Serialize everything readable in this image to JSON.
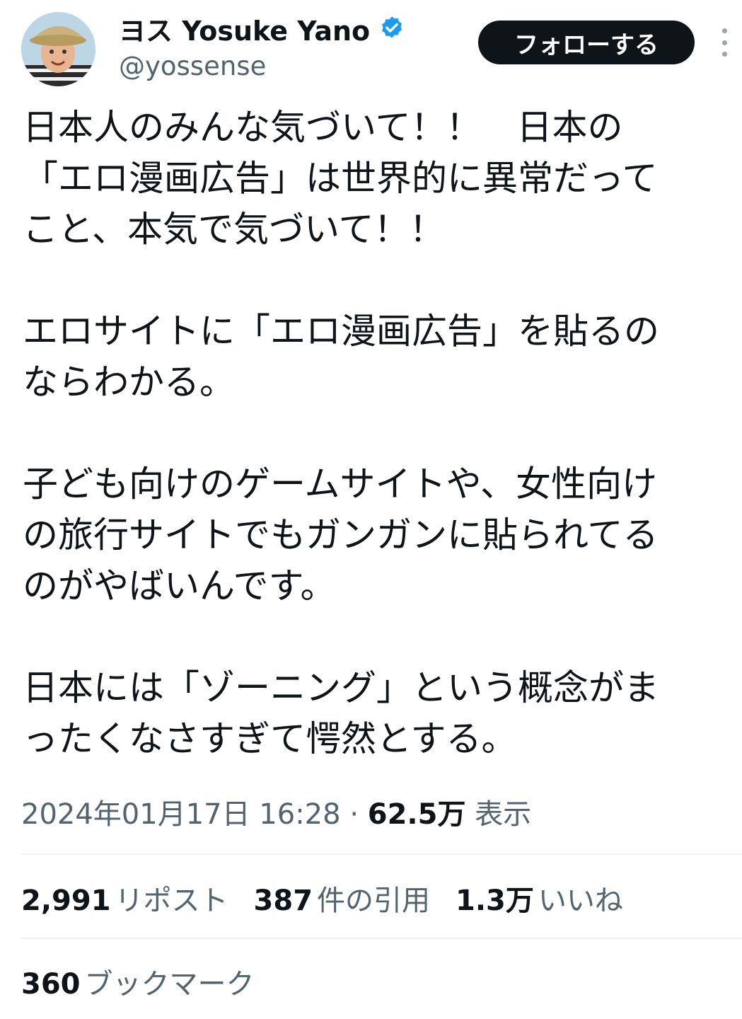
{
  "author": {
    "display_name": "ヨス Yosuke Yano",
    "handle": "@yossense",
    "verified_icon": "verified-badge-icon",
    "verified_color": "#1d9bf0"
  },
  "actions": {
    "follow_label": "フォローする",
    "more_icon": "more-vertical-icon"
  },
  "tweet": {
    "lines": [
      "日本人のみんな気づいて！！　日本の",
      "「エロ漫画広告」は世界的に異常だって",
      "こと、本気で気づいて！！",
      "",
      "エロサイトに「エロ漫画広告」を貼るの",
      "ならわかる。",
      "",
      "子ども向けのゲームサイトや、女性向け",
      "の旅行サイトでもガンガンに貼られてる",
      "のがやばいんです。",
      "",
      "日本には「ゾーニング」という概念がま",
      "ったくなさすぎて愕然とする。"
    ]
  },
  "meta": {
    "timestamp": "2024年01月17日 16:28",
    "separator": "·",
    "views_count": "62.5万",
    "views_label": "表示"
  },
  "stats": {
    "reposts_count": "2,991",
    "reposts_label": "リポスト",
    "quotes_count": "387",
    "quotes_label": "件の引用",
    "likes_count": "1.3万",
    "likes_label": "いいね",
    "bookmarks_count": "360",
    "bookmarks_label": "ブックマーク"
  },
  "colors": {
    "text": "#0f1419",
    "secondary": "#536471",
    "divider": "#eff3f4",
    "button_bg": "#0f1419"
  }
}
